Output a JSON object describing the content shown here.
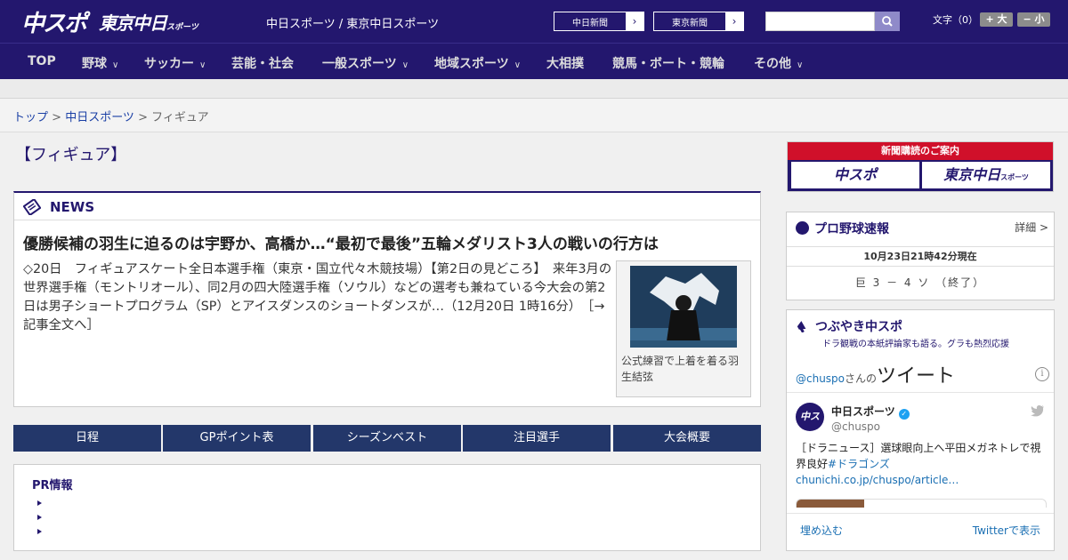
{
  "header": {
    "logo_chuspo": "中スポ",
    "logo_tokyo": "東京中日",
    "logo_tokyo_small": "スポーツ",
    "site_links": "中日スポーツ / 東京中日スポーツ",
    "btn_chunichi": "中日新聞",
    "btn_tokyo": "東京新聞",
    "search_placeholder": "",
    "fontsize_label": "文字（0）",
    "font_bigger": "+ 大",
    "font_smaller": "− 小"
  },
  "nav": [
    {
      "label": "TOP",
      "has_dropdown": false
    },
    {
      "label": "野球",
      "has_dropdown": true
    },
    {
      "label": "サッカー",
      "has_dropdown": true
    },
    {
      "label": "芸能・社会",
      "has_dropdown": false
    },
    {
      "label": "一般スポーツ",
      "has_dropdown": true
    },
    {
      "label": "地域スポーツ",
      "has_dropdown": true
    },
    {
      "label": "大相撲",
      "has_dropdown": false
    },
    {
      "label": "競馬・ボート・競輪",
      "has_dropdown": false
    },
    {
      "label": "その他",
      "has_dropdown": true
    }
  ],
  "breadcrumb": {
    "top": "トップ",
    "sep": " > ",
    "chuspo": "中日スポーツ",
    "current": "フィギュア"
  },
  "page_title": "【フィギュア】",
  "news": {
    "section_label": "NEWS",
    "headline": "優勝候補の羽生に迫るのは宇野か、高橋か…“最初で最後”五輪メダリスト3人の戦いの行方は",
    "body": "◇20日　フィギュアスケート全日本選手権（東京・国立代々木競技場）【第2日の見どころ】　来年3月の世界選手権（モントリオール）、同2月の四大陸選手権（ソウル）などの選考も兼ねている今大会の第2日は男子ショートプログラム（SP）とアイスダンスのショートダンスが…（12月20日 1時16分）　［→記事全文へ］",
    "photo_caption": "公式練習で上着を着る羽生結弦"
  },
  "tabs": [
    "日程",
    "GPポイント表",
    "シーズンベスト",
    "注目選手",
    "大会概要"
  ],
  "pr": {
    "title": "PR情報",
    "items": [
      "",
      "",
      ""
    ]
  },
  "sidebar": {
    "subscribe_title": "新聞購読のご案内",
    "subscribe_chuspo": "中スポ",
    "subscribe_tokyo": "東京中日",
    "subscribe_tokyo_small": "スポーツ",
    "baseball": {
      "title": "プロ野球速報",
      "more": "詳細 >",
      "timestamp": "10月23日21時42分現在",
      "score": "巨 3 － 4 ソ （終了）"
    },
    "twitter": {
      "title": "つぶやき中スポ",
      "subtitle": "ドラ観戦の本紙評論家も語る。グラも熱烈応援",
      "handle_link": "@chuspo",
      "handle_suffix": "さんの",
      "tweets_label": "ツイート",
      "info_icon": "i",
      "account_name": "中日スポーツ",
      "account_handle": "@chuspo",
      "avatar_text": "中スポ",
      "tweet_text": "［ドラニュース］選球眼向上へ平田メガネトレで視界良好",
      "tweet_hashtag": "#ドラゴンズ",
      "tweet_url": "chunichi.co.jp/chuspo/article…",
      "embed": "埋め込む",
      "view_on_twitter": "Twitterで表示"
    }
  },
  "colors": {
    "brand_navy": "#23176e",
    "tab_bg": "#23376a",
    "subscribe_red": "#d0102a",
    "link_blue": "#1a3fa5"
  }
}
